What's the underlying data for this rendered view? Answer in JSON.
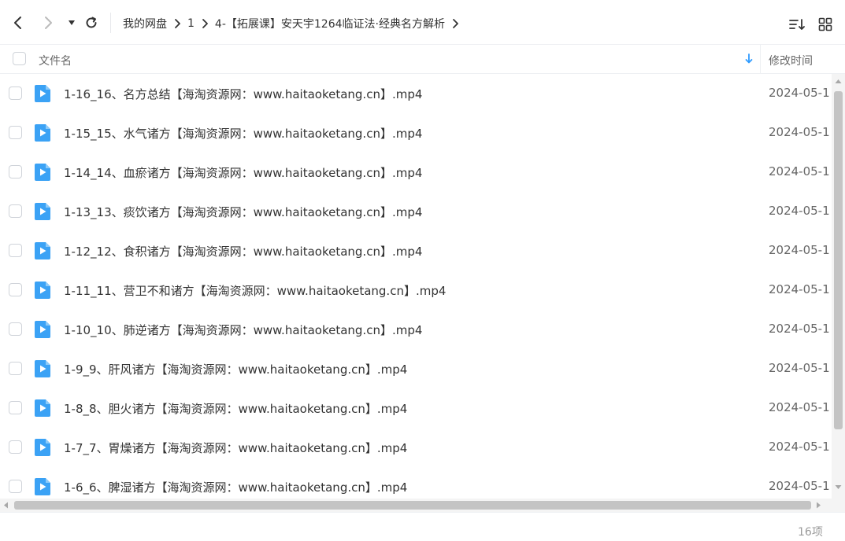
{
  "breadcrumb": [
    "我的网盘",
    "1",
    "4-【拓展课】安天宇1264临证法·经典名方解析"
  ],
  "header": {
    "name_label": "文件名",
    "time_label": "修改时间"
  },
  "files": [
    {
      "name": "1-16_16、名方总结【海淘资源网：www.haitaoketang.cn】.mp4",
      "modified": "2024-05-1"
    },
    {
      "name": "1-15_15、水气诸方【海淘资源网：www.haitaoketang.cn】.mp4",
      "modified": "2024-05-1"
    },
    {
      "name": "1-14_14、血瘀诸方【海淘资源网：www.haitaoketang.cn】.mp4",
      "modified": "2024-05-1"
    },
    {
      "name": "1-13_13、痰饮诸方【海淘资源网：www.haitaoketang.cn】.mp4",
      "modified": "2024-05-1"
    },
    {
      "name": "1-12_12、食积诸方【海淘资源网：www.haitaoketang.cn】.mp4",
      "modified": "2024-05-1"
    },
    {
      "name": "1-11_11、营卫不和诸方【海淘资源网：www.haitaoketang.cn】.mp4",
      "modified": "2024-05-1"
    },
    {
      "name": "1-10_10、肺逆诸方【海淘资源网：www.haitaoketang.cn】.mp4",
      "modified": "2024-05-1"
    },
    {
      "name": "1-9_9、肝风诸方【海淘资源网：www.haitaoketang.cn】.mp4",
      "modified": "2024-05-1"
    },
    {
      "name": "1-8_8、胆火诸方【海淘资源网：www.haitaoketang.cn】.mp4",
      "modified": "2024-05-1"
    },
    {
      "name": "1-7_7、胃燥诸方【海淘资源网：www.haitaoketang.cn】.mp4",
      "modified": "2024-05-1"
    },
    {
      "name": "1-6_6、脾湿诸方【海淘资源网：www.haitaoketang.cn】.mp4",
      "modified": "2024-05-1"
    }
  ],
  "footer": {
    "count": "16项"
  },
  "colors": {
    "accent": "#2f9bff",
    "icon_fill": "#3ba2f5",
    "text": "#333333",
    "muted": "#999999"
  },
  "icons": {
    "back": "chevron-left-icon",
    "forward": "chevron-right-icon",
    "dropdown": "caret-down-icon",
    "refresh": "refresh-icon",
    "breadcrumb_separator": "chevron-right-icon",
    "sort": "sort-list-icon",
    "grid_view": "grid-view-icon",
    "video_file": "video-file-icon",
    "sort_direction": "arrow-down-icon"
  }
}
